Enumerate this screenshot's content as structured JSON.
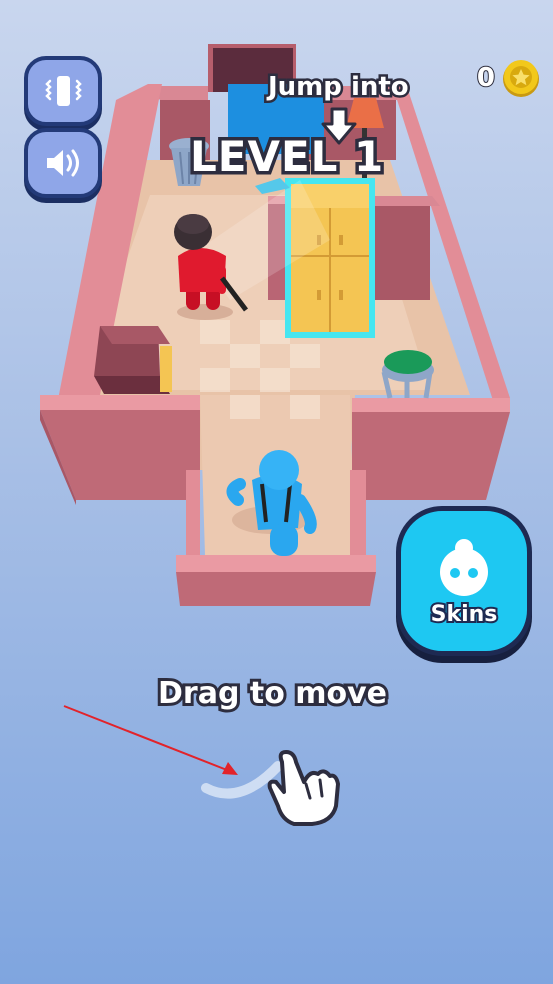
{
  "hud": {
    "vibration_icon": "phone-vibrate-icon",
    "sound_icon": "speaker-icon",
    "coin_count": "0",
    "coin_icon": "coin-star-icon"
  },
  "level": {
    "hint": "Jump into",
    "title": "LEVEL 1"
  },
  "tutorial": {
    "instruction": "Drag to move",
    "hand_icon": "pointing-hand-icon",
    "arrow_color": "#e2232a"
  },
  "skins_button": {
    "label": "Skins",
    "icon": "character-head-icon",
    "color": "#1ec8f2"
  },
  "colors": {
    "wall": "#c9707b",
    "wall_top": "#e9939b",
    "floor": "#e9c5ad",
    "player": "#2aa7ef",
    "guard": "#d8152a",
    "wardrobe": "#f2c04e",
    "highlight": "#46e6f0"
  }
}
